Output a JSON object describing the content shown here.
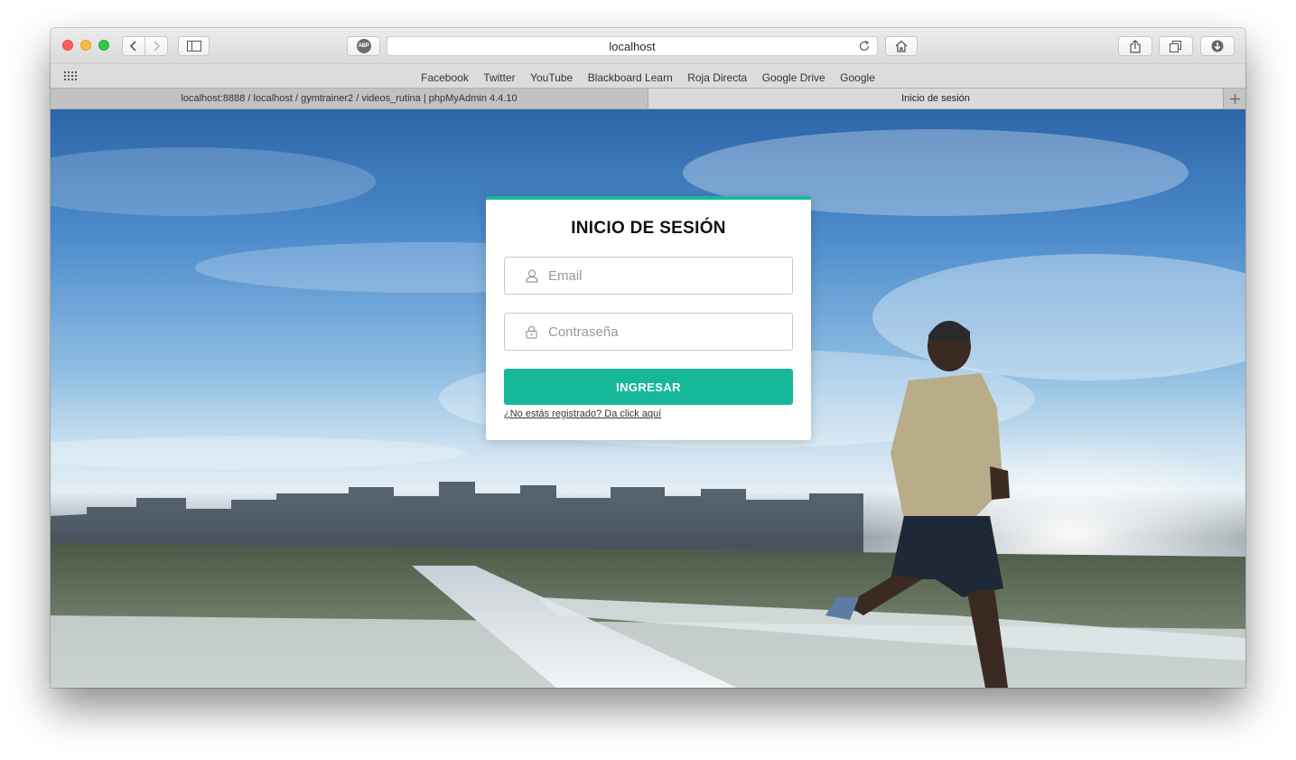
{
  "browser": {
    "address": "localhost",
    "abp_label": "ABP",
    "bookmarks": [
      "Facebook",
      "Twitter",
      "YouTube",
      "Blackboard Learn",
      "Roja Directa",
      "Google Drive",
      "Google"
    ],
    "tabs": [
      {
        "label": "localhost:8888 / localhost / gymtrainer2 / videos_rutina | phpMyAdmin 4.4.10",
        "active": false
      },
      {
        "label": "Inicio de sesión",
        "active": true
      }
    ]
  },
  "login": {
    "title": "INICIO DE SESIÓN",
    "email_placeholder": "Email",
    "email_value": "",
    "password_placeholder": "Contraseña",
    "password_value": "",
    "submit_label": "INGRESAR",
    "register_link": "¿No estás registrado? Da click aquí"
  },
  "icons": {
    "email_field": "user-icon",
    "password_field": "lock-icon",
    "toolbar": [
      "back-icon",
      "forward-icon",
      "sidebar-icon",
      "abp-icon",
      "reload-icon",
      "home-icon",
      "share-icon",
      "tabs-icon",
      "download-icon",
      "grid-icon",
      "plus-icon"
    ]
  },
  "colors": {
    "accent": "#17b89a",
    "close": "#fc605c",
    "minimize": "#fdbc40",
    "zoom": "#34c84a"
  }
}
